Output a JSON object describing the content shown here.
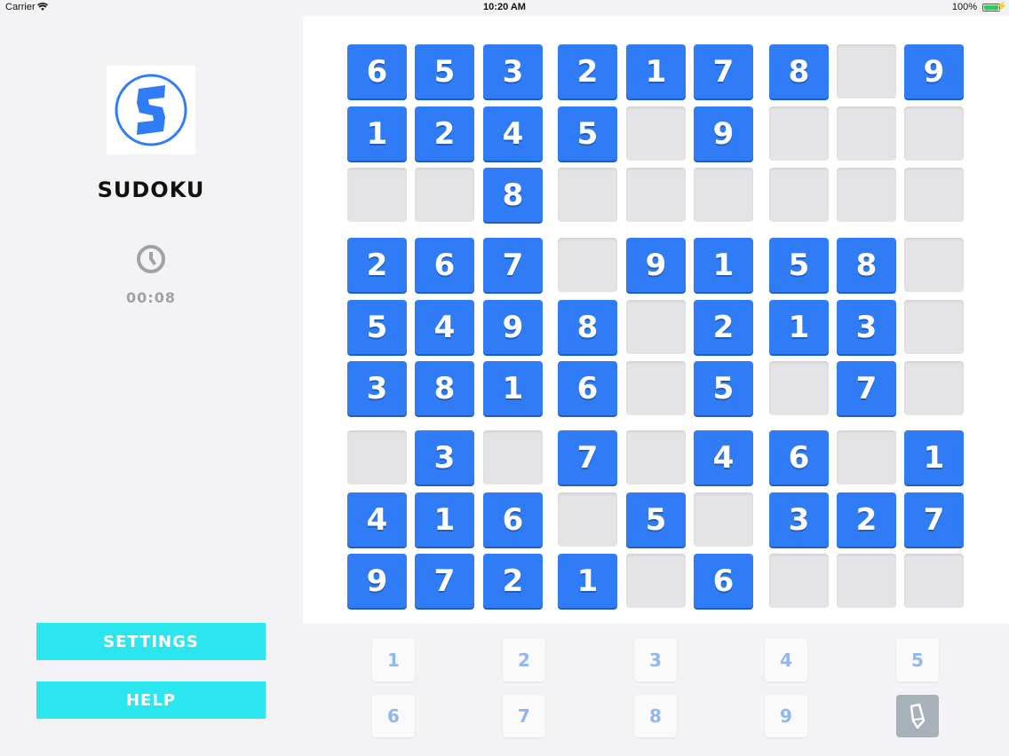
{
  "status_bar": {
    "carrier": "Carrier",
    "time": "10:20 AM",
    "battery": "100%",
    "battery_level": 1.0
  },
  "app": {
    "title": "SUDOKU",
    "logo_letter": "S",
    "timer": "00:08"
  },
  "menu": {
    "settings_label": "SETTINGS",
    "help_label": "HELP"
  },
  "colors": {
    "tile": "#2f7cf6",
    "empty": "#e4e4e6",
    "button": "#2be6ef",
    "keypad_text": "#92b6f0"
  },
  "board": [
    [
      "6",
      "5",
      "3",
      "2",
      "1",
      "7",
      "8",
      "",
      "9"
    ],
    [
      "1",
      "2",
      "4",
      "5",
      "",
      "9",
      "",
      "",
      ""
    ],
    [
      "",
      "",
      "8",
      "",
      "",
      "",
      "",
      "",
      ""
    ],
    [
      "2",
      "6",
      "7",
      "",
      "9",
      "1",
      "5",
      "8",
      ""
    ],
    [
      "5",
      "4",
      "9",
      "8",
      "",
      "2",
      "1",
      "3",
      ""
    ],
    [
      "3",
      "8",
      "1",
      "6",
      "",
      "5",
      "",
      "7",
      ""
    ],
    [
      "",
      "3",
      "",
      "7",
      "",
      "4",
      "6",
      "",
      "1"
    ],
    [
      "4",
      "1",
      "6",
      "",
      "5",
      "",
      "3",
      "2",
      "7"
    ],
    [
      "9",
      "7",
      "2",
      "1",
      "",
      "6",
      "",
      "",
      ""
    ]
  ],
  "keypad": {
    "row1": [
      "1",
      "2",
      "3",
      "4",
      "5"
    ],
    "row2": [
      "6",
      "7",
      "8",
      "9"
    ],
    "pencil_icon": "pencil-icon"
  }
}
